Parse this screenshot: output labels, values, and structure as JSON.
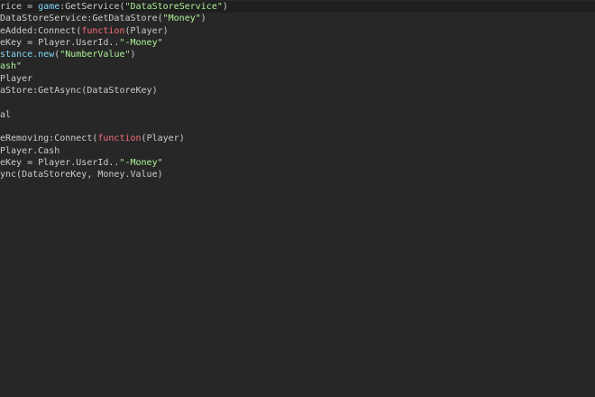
{
  "colors": {
    "background": "#272727",
    "current_line": "#1f1f1f",
    "default": "#cccccc",
    "keyword": "#f86d7c",
    "builtin": "#84d6f7",
    "string": "#adf195"
  },
  "code": {
    "lines": [
      [
        {
          "text": "rice = ",
          "type": "default"
        },
        {
          "text": "game",
          "type": "builtin"
        },
        {
          "text": ":GetService(",
          "type": "default"
        },
        {
          "text": "\"DataStoreService\"",
          "type": "string"
        },
        {
          "text": ")",
          "type": "default"
        }
      ],
      [
        {
          "text": "DataStoreService:GetDataStore(",
          "type": "default"
        },
        {
          "text": "\"Money\"",
          "type": "string"
        },
        {
          "text": ")",
          "type": "default"
        }
      ],
      [
        {
          "text": "eAdded:Connect(",
          "type": "default"
        },
        {
          "text": "function",
          "type": "keyword"
        },
        {
          "text": "(Player)",
          "type": "default"
        }
      ],
      [
        {
          "text": "eKey = Player.UserId..",
          "type": "default"
        },
        {
          "text": "\"-Money\"",
          "type": "string"
        }
      ],
      [
        {
          "text": "stance.",
          "type": "builtin"
        },
        {
          "text": "new",
          "type": "builtin"
        },
        {
          "text": "(",
          "type": "default"
        },
        {
          "text": "\"NumberValue\"",
          "type": "string"
        },
        {
          "text": ")",
          "type": "default"
        }
      ],
      [
        {
          "text": "ash\"",
          "type": "string"
        }
      ],
      [
        {
          "text": "Player",
          "type": "default"
        }
      ],
      [
        {
          "text": "aStore:GetAsync(DataStoreKey)",
          "type": "default"
        }
      ],
      [],
      [
        {
          "text": "al",
          "type": "default"
        }
      ],
      [],
      [
        {
          "text": "eRemoving:Connect(",
          "type": "default"
        },
        {
          "text": "function",
          "type": "keyword"
        },
        {
          "text": "(Player)",
          "type": "default"
        }
      ],
      [
        {
          "text": "Player.Cash",
          "type": "default"
        }
      ],
      [
        {
          "text": "eKey = Player.UserId..",
          "type": "default"
        },
        {
          "text": "\"-Money\"",
          "type": "string"
        }
      ],
      [
        {
          "text": "ync(DataStoreKey, Money.Value)",
          "type": "default"
        }
      ]
    ]
  }
}
